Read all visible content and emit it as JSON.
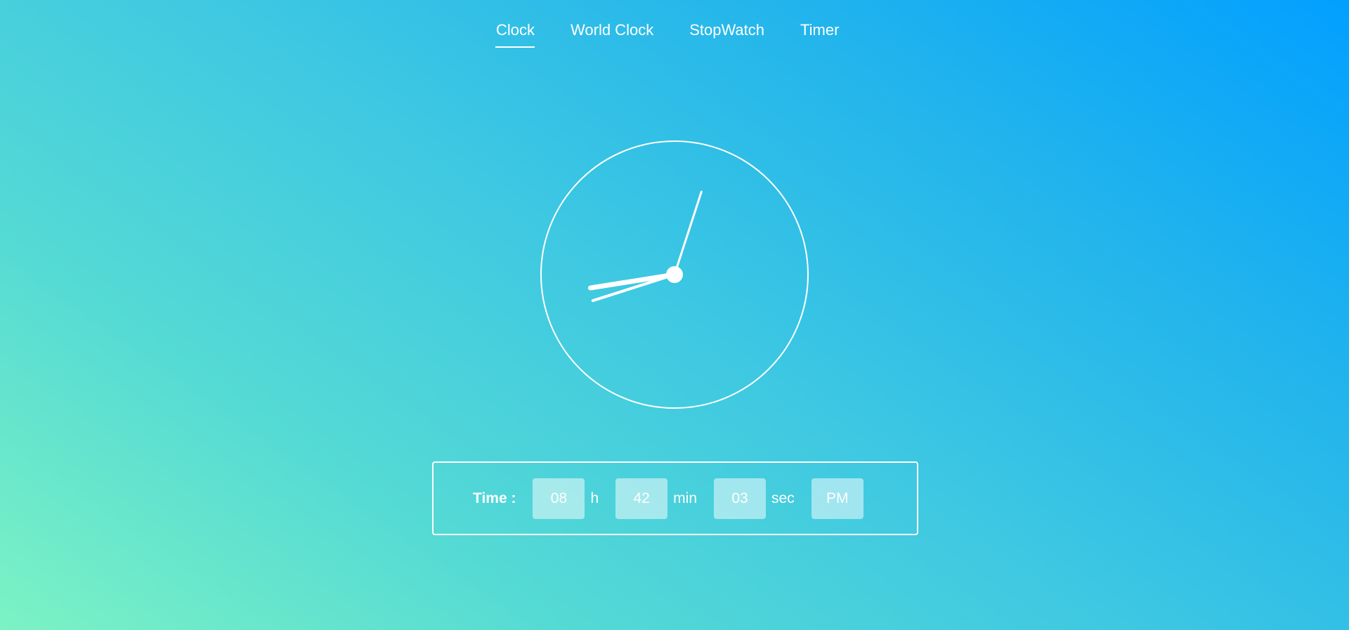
{
  "nav": {
    "items": [
      {
        "label": "Clock",
        "active": true
      },
      {
        "label": "World Clock"
      },
      {
        "label": "StopWatch"
      },
      {
        "label": "Timer"
      }
    ]
  },
  "time": {
    "label": "Time :",
    "hours": "08",
    "hours_unit": "h",
    "minutes": "42",
    "minutes_unit": "min",
    "seconds": "03",
    "seconds_unit": "sec",
    "period": "PM"
  }
}
